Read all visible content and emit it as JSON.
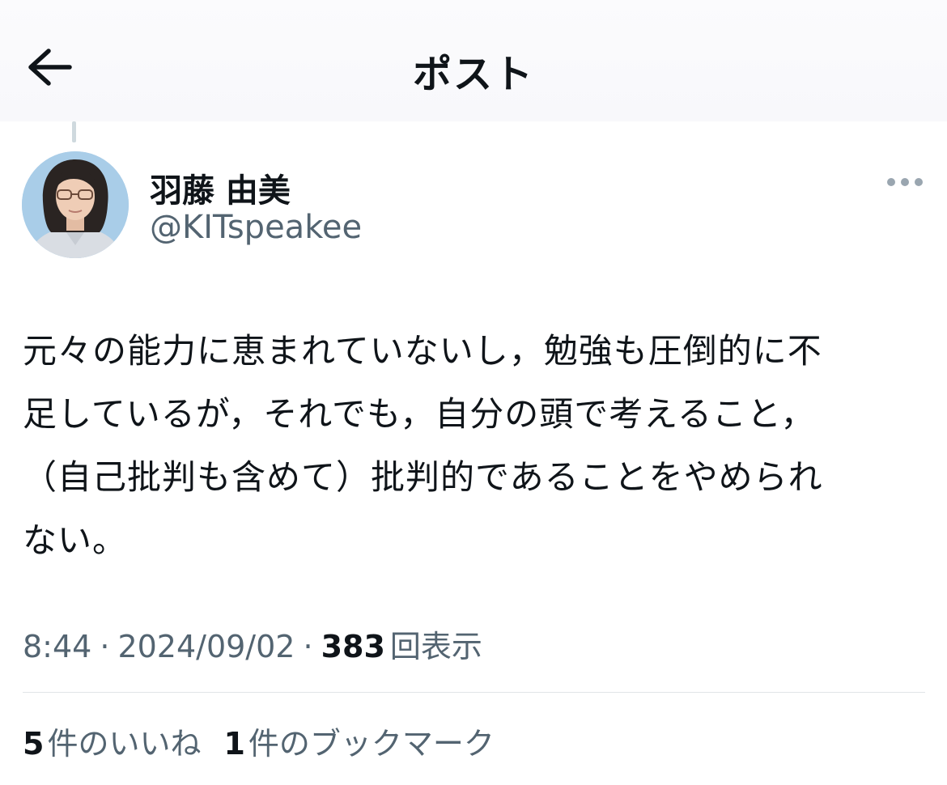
{
  "header": {
    "title": "ポスト",
    "back_icon": "arrow-left-icon"
  },
  "author": {
    "display_name": "羽藤 由美",
    "handle": "@KITspeakee",
    "more_icon": "more-dots-icon"
  },
  "post": {
    "text": "元々の能力に恵まれていないし，勉強も圧倒的に不\n足しているが，それでも，自分の頭で考えること，\n（自己批判も含めて）批判的であることをやめられ\nない。"
  },
  "meta": {
    "time": "8:44",
    "separator": "·",
    "date": "2024/09/02",
    "views_count": "383",
    "views_label": "回表示"
  },
  "stats": {
    "likes_count": "5",
    "likes_label": "件のいいね",
    "bookmarks_count": "1",
    "bookmarks_label": "件のブックマーク"
  },
  "colors": {
    "text_primary": "#0f1419",
    "text_secondary": "#536471",
    "divider": "#e1e5e8",
    "thread_line": "#cfd9de"
  }
}
